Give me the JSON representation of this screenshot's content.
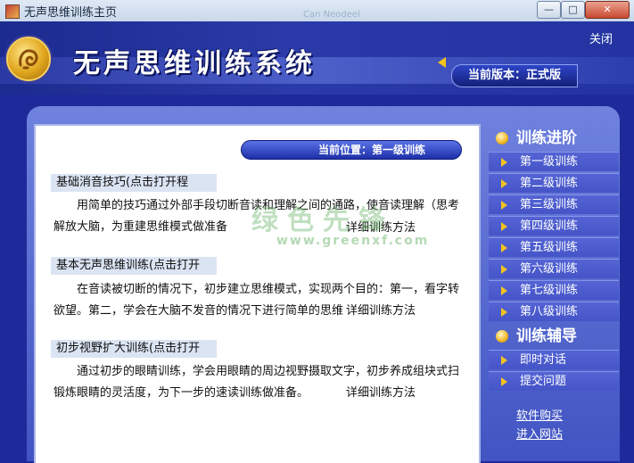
{
  "window": {
    "title": "无声思维训练主页",
    "ghost_text": "Can Neodeel",
    "min_glyph": "—",
    "max_glyph": "□",
    "close_glyph": "✕"
  },
  "header": {
    "app_title": "无声思维训练系统",
    "close_label": "关闭",
    "version_label": "当前版本：正式版"
  },
  "content": {
    "location": "当前位置：第一级训练",
    "sections": [
      {
        "title": "基础消音技巧(点击打开程",
        "line1": "用简单的技巧通过外部手段切断音读和理解之间的通路，使音读理解（思考",
        "line2": "解放大脑，为重建思维模式做准备",
        "detail_label": "详细训练方法"
      },
      {
        "title": "基本无声思维训练(点击打开",
        "line1": "在音读被切断的情况下，初步建立思维模式，实现两个目的：第一，看字转",
        "line2": "欲望。第二，学会在大脑不发音的情况下进行简单的思维活动。",
        "detail_label": "详细训练方法"
      },
      {
        "title": "初步视野扩大训练(点击打开",
        "line1": "通过初步的眼睛训练，学会用眼睛的周边视野摄取文字，初步养成组块式扫",
        "line2": "锻炼眼睛的灵活度，为下一步的速读训练做准备。",
        "detail_label": "详细训练方法"
      }
    ]
  },
  "watermark": {
    "text": "绿色先锋",
    "url": "www.greenxf.com"
  },
  "sidebar": {
    "progress_title": "训练进阶",
    "levels": [
      "第一级训练",
      "第二级训练",
      "第三级训练",
      "第四级训练",
      "第五级训练",
      "第六级训练",
      "第七级训练",
      "第八级训练"
    ],
    "aux_title": "训练辅导",
    "aux_items": [
      "即时对话",
      "提交问题"
    ],
    "links": [
      "软件购买",
      "进入网站"
    ]
  },
  "colors": {
    "brand_blue": "#2334a2",
    "accent_gold": "#f2c21b",
    "panel_white": "#ffffff"
  }
}
